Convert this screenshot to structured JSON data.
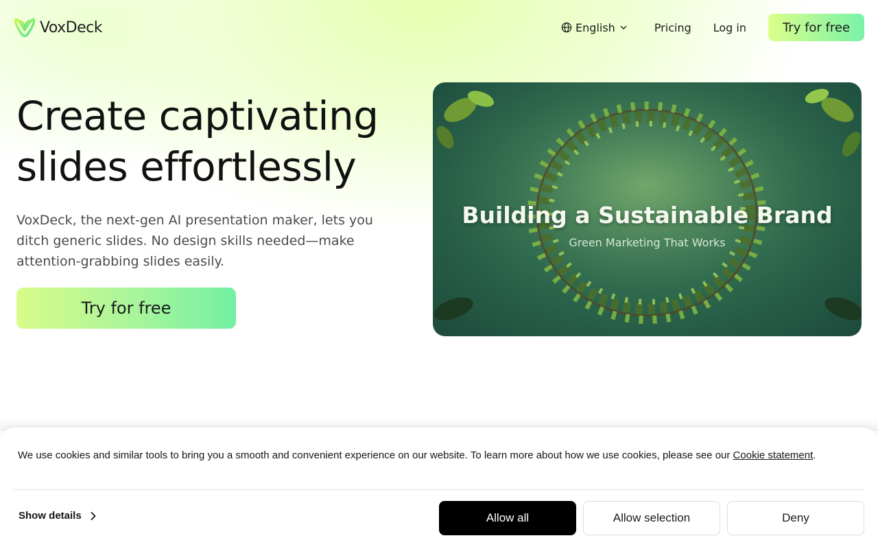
{
  "brand": {
    "name": "VoxDeck",
    "accent": "#b6f98c",
    "accent2": "#72f0a2"
  },
  "nav": {
    "language": "English",
    "pricing": "Pricing",
    "login": "Log in",
    "cta": "Try for free"
  },
  "hero": {
    "title_line1": "Create captivating",
    "title_line2": "slides effortlessly",
    "description": "VoxDeck, the next-gen AI presentation maker, lets you ditch generic slides. No design skills needed—make attention-grabbing slides easily.",
    "cta": "Try for free",
    "media": {
      "title": "Building a Sustainable Brand",
      "subtitle": "Green Marketing That Works"
    }
  },
  "cookie_banner": {
    "text": "We use cookies and similar tools to bring you a smooth and convenient experience on our website. To learn more about how we use cookies, please see our ",
    "link_text": "Cookie statement",
    "text_end": ".",
    "show_details": "Show details",
    "allow_all": "Allow all",
    "allow_selection": "Allow selection",
    "deny": "Deny"
  }
}
